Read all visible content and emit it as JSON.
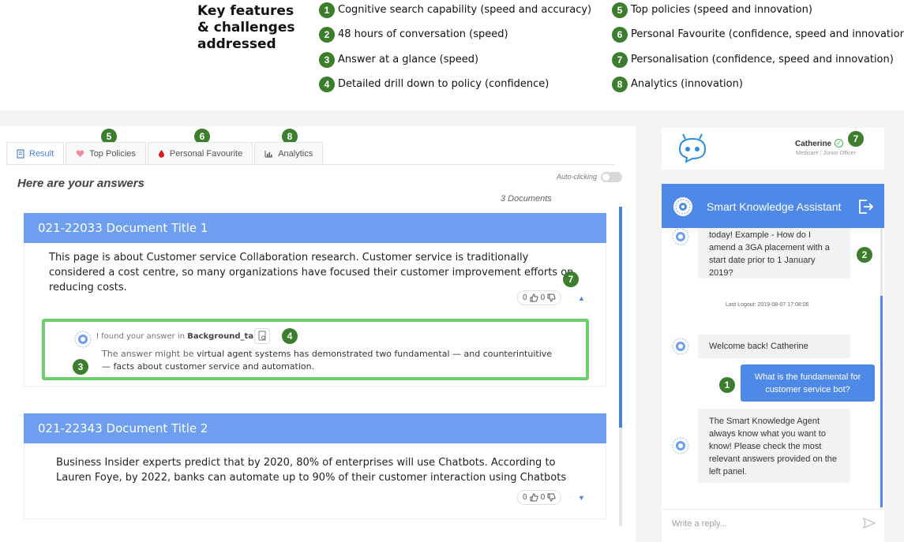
{
  "legend": {
    "title": "Key features & challenges addressed",
    "items": [
      {
        "num": "1",
        "text": "Cognitive search capability (speed and accuracy)"
      },
      {
        "num": "2",
        "text": "48 hours of conversation (speed)"
      },
      {
        "num": "3",
        "text": "Answer at a glance (speed)"
      },
      {
        "num": "4",
        "text": "Detailed drill down to policy (confidence)"
      },
      {
        "num": "5",
        "text": "Top policies (speed and innovation)"
      },
      {
        "num": "6",
        "text": "Personal Favourite (confidence, speed and innovation)"
      },
      {
        "num": "7",
        "text": "Personalisation (confidence, speed and innovation)"
      },
      {
        "num": "8",
        "text": "Analytics (innovation)"
      }
    ]
  },
  "tabs": [
    {
      "label": "Result",
      "icon": "document-icon"
    },
    {
      "label": "Top Policies",
      "icon": "heart-icon"
    },
    {
      "label": "Personal Favourite",
      "icon": "drop-icon"
    },
    {
      "label": "Analytics",
      "icon": "bar-chart-icon"
    }
  ],
  "main": {
    "title": "Here are your answers",
    "auto_clicking": "Auto-clicking",
    "doc_count": "3 Documents"
  },
  "documents": [
    {
      "title": "021-22033 Document Title 1",
      "body": "This page is about Customer service Collaboration research. Customer service is traditionally considered a cost centre, so many organizations have focused their customer improvement efforts on reducing costs.",
      "likes": "0",
      "dislikes": "0"
    },
    {
      "title": "021-22343 Document Title 2",
      "body": "Business Insider experts predict that by 2020, 80% of enterprises will use Chatbots. According to Lauren Foye, by 2022,  banks can automate up to 90% of their customer interaction using Chatbots",
      "likes": "0",
      "dislikes": "0"
    }
  ],
  "answer": {
    "found_prefix": "I found your answer in ",
    "found_source": "Background_tab",
    "text_prefix": "The answer might be ",
    "text": "virtual agent systems has demonstrated two fundamental — and counterintuitive — facts about customer service and automation."
  },
  "profile": {
    "name": "Catherine",
    "department": "Medicare",
    "role": "Junior Officer"
  },
  "chat": {
    "title": "Smart Knowledge Assistant",
    "messages": [
      {
        "from": "bot",
        "text": "today! Example - How do I amend a 3GA placement with a start date prior to 1 January 2019?"
      },
      {
        "from": "system",
        "text": "Last Logout: 2019-08-07 17:08:06"
      },
      {
        "from": "bot",
        "text": "Welcome back! Catherine"
      },
      {
        "from": "user",
        "text": "What is the fundamental for customer service bot?"
      },
      {
        "from": "bot",
        "text": "The Smart Knowledge Agent always know what you want to know! Please check the most relevant answers provided on the left panel."
      }
    ],
    "reply_placeholder": "Write a reply..."
  },
  "badges": {
    "top_policies": "5",
    "personal_favourite": "6",
    "analytics": "8",
    "doc_vote": "7",
    "drill_down": "4",
    "glance": "3",
    "profile": "7",
    "chat_history": "2",
    "user_query": "1"
  },
  "colors": {
    "accent_blue": "#4e89e8",
    "card_header_blue": "#6d9ef0",
    "badge_green": "#3d7d2e",
    "answer_border_green": "#6fce6d"
  }
}
